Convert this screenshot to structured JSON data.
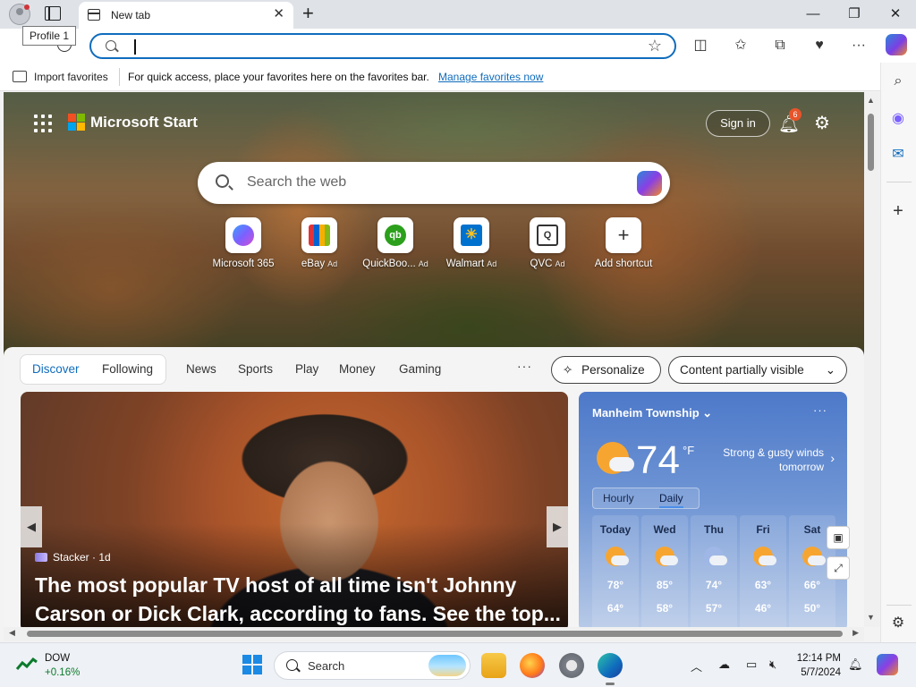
{
  "browser": {
    "tab_title": "New tab",
    "tooltip": "Profile 1",
    "favorites": {
      "import_label": "Import favorites",
      "message": "For quick access, place your favorites here on the favorites bar.",
      "link": "Manage favorites now"
    }
  },
  "msn": {
    "brand": "Microsoft Start",
    "signin": "Sign in",
    "notification_count": "6",
    "search_placeholder": "Search the web",
    "shortcuts": [
      {
        "label": "Microsoft 365",
        "ad": "",
        "color": "#7b61ff"
      },
      {
        "label": "eBay",
        "ad": "Ad",
        "color": "#e53238"
      },
      {
        "label": "QuickBoo...",
        "ad": "Ad",
        "color": "#2ca01c"
      },
      {
        "label": "Walmart",
        "ad": "Ad",
        "color": "#0071ce"
      },
      {
        "label": "QVC",
        "ad": "Ad",
        "color": "#ffffff"
      },
      {
        "label": "Add shortcut",
        "ad": "",
        "color": "#ffffff"
      }
    ],
    "feed_nav": {
      "discover": "Discover",
      "following": "Following",
      "items": [
        "News",
        "Sports",
        "Play",
        "Money",
        "Gaming"
      ],
      "more": "···",
      "personalize": "Personalize",
      "content_filter": "Content partially visible"
    },
    "story": {
      "source": "Stacker · 1d",
      "title": "The most popular TV host of all time isn't Johnny Carson or Dick Clark, according to fans. See the top..."
    },
    "weather": {
      "location": "Manheim Township",
      "temp": "74",
      "unit": "°F",
      "condition": "Strong & gusty winds tomorrow",
      "tab_hourly": "Hourly",
      "tab_daily": "Daily",
      "days": [
        {
          "name": "Today",
          "hi": "78°",
          "lo": "64°"
        },
        {
          "name": "Wed",
          "hi": "85°",
          "lo": "58°"
        },
        {
          "name": "Thu",
          "hi": "74°",
          "lo": "57°"
        },
        {
          "name": "Fri",
          "hi": "63°",
          "lo": "46°"
        },
        {
          "name": "Sat",
          "hi": "66°",
          "lo": "50°"
        }
      ]
    }
  },
  "taskbar": {
    "stock_name": "DOW",
    "stock_change": "+0.16%",
    "search_label": "Search",
    "time": "12:14 PM",
    "date": "5/7/2024"
  },
  "colors": {
    "accent": "#0f6cbd",
    "stock_up": "#0c7a2c",
    "badge": "#e8542a"
  }
}
